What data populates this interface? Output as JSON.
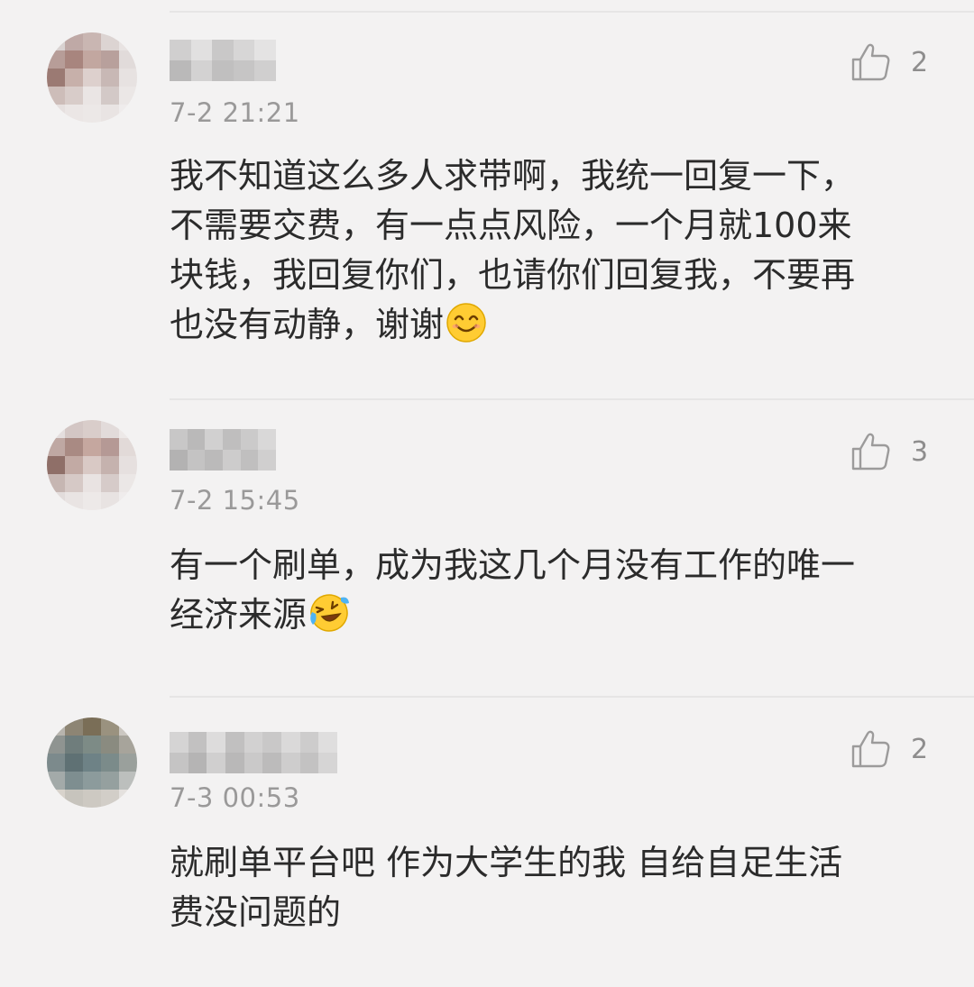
{
  "comments": [
    {
      "time": "7-2 21:21",
      "likes": "2",
      "text": "我不知道这么多人求带啊，我统一回复一下，\n不需要交费，有一点点风险，一个月就100来\n块钱，我回复你们，也请你们回复我，不要再\n也没有动静，谢谢",
      "emoji_icon": "smiling-face-icon"
    },
    {
      "time": "7-2 15:45",
      "likes": "3",
      "text": "有一个刷单，成为我这几个月没有工作的唯一\n经济来源",
      "emoji_icon": "laughing-crying-face-icon"
    },
    {
      "time": "7-3 00:53",
      "likes": "2",
      "text": "就刷单平台吧  作为大学生的我 自给自足生活\n费没问题的"
    }
  ],
  "icons": {
    "like": "thumbs-up-icon"
  },
  "colors": {
    "background": "#f3f2f2",
    "text": "#2b2b2b",
    "meta": "#9a9999"
  }
}
